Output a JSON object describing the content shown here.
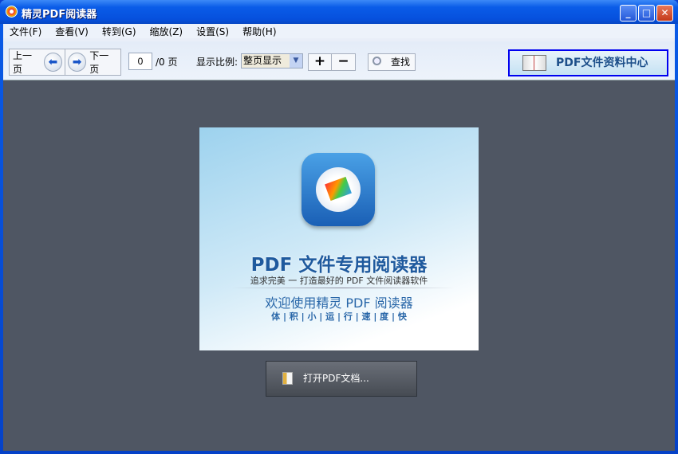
{
  "window": {
    "title": "精灵PDF阅读器",
    "minimize": "_",
    "maximize": "□",
    "close": "✕"
  },
  "menu": [
    "文件(F)",
    "查看(V)",
    "转到(G)",
    "缩放(Z)",
    "设置(S)",
    "帮助(H)"
  ],
  "toolbar": {
    "prev": "上一页",
    "next": "下一页",
    "page_value": "0",
    "page_total": "/0 页",
    "zoom_label": "显示比例:",
    "zoom_value": "整页显示",
    "zoom_in": "+",
    "zoom_out": "−",
    "find": "查找",
    "center": "PDF文件资料中心"
  },
  "splash": {
    "headline": "PDF 文件专用阅读器",
    "tagline": "追求完美 一 打造最好的 PDF 文件阅读器软件",
    "welcome": "欢迎使用精灵 PDF 阅读器",
    "features": "体 | 积 | 小 | 运 | 行 | 速 | 度 | 快"
  },
  "open_button": "打开PDF文档..."
}
